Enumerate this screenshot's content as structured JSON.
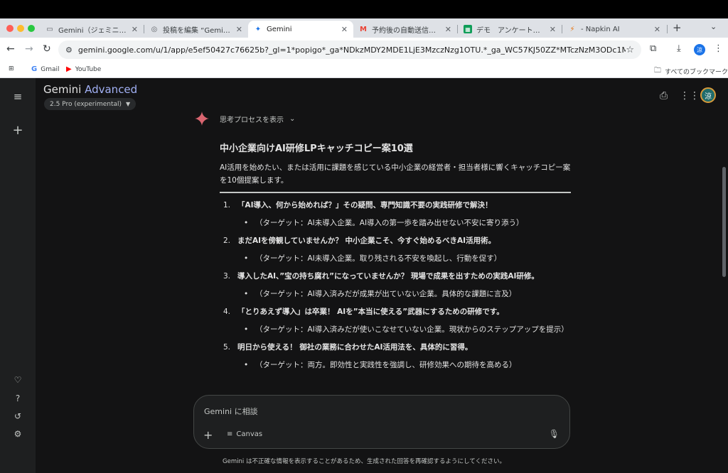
{
  "browser": {
    "tabs": [
      {
        "title": "Gemini（ジェミニ）とは？",
        "icon": "document-icon",
        "active": false
      },
      {
        "title": "投稿を編集 “Gemini（ジェミ",
        "icon": "wordpress-icon",
        "active": false
      },
      {
        "title": "Gemini",
        "icon": "gemini-icon",
        "active": true
      },
      {
        "title": "予約後の自動送信メールの",
        "icon": "gmail-icon",
        "active": false
      },
      {
        "title": "デモ　アンケート結果 - Go",
        "icon": "sheets-icon",
        "active": false
      },
      {
        "title": "- Napkin AI",
        "icon": "napkin-icon",
        "active": false
      }
    ],
    "url": "gemini.google.com/u/1/app/e5ef50427c76625b?_gl=1*popigo*_ga*NDkzMDY2MDE1LjE3MzczNzg1OTU.*_ga_WC57KJ50ZZ*MTczNzM3ODc1MS4xLjAuMTczNzM3...",
    "profile_initial": "涼",
    "bookmarks": [
      {
        "label": "Gmail",
        "icon": "google-icon"
      },
      {
        "label": "YouTube",
        "icon": "youtube-icon"
      }
    ],
    "all_bookmarks_label": "すべてのブックマーク"
  },
  "app": {
    "brand": "Gemini",
    "brand_suffix": "Advanced",
    "model": "2.5 Pro (experimental)",
    "user_initial": "涼",
    "thinking_label": "思考プロセスを表示",
    "response": {
      "title": "中小企業向けAI研修LPキャッチコピー案10選",
      "intro": "AI活用を始めたい、または活用に課題を感じている中小企業の経営者・担当者様に響くキャッチコピー案を10個提案します。",
      "items": [
        {
          "num": "1.",
          "title": "「AI導入、何から始めれば？」その疑問、専門知識不要の実践研修で解決！",
          "sub": "（ターゲット：AI未導入企業。AI導入の第一歩を踏み出せない不安に寄り添う）"
        },
        {
          "num": "2.",
          "title": "まだAIを傍観していませんか？ 中小企業こそ、今すぐ始めるべきAI活用術。",
          "sub": "（ターゲット：AI未導入企業。取り残される不安を喚起し、行動を促す）"
        },
        {
          "num": "3.",
          "title": "導入したAI、”宝の持ち腐れ”になっていませんか？ 現場で成果を出すための実践AI研修。",
          "sub": "（ターゲット：AI導入済みだが成果が出ていない企業。具体的な課題に言及）"
        },
        {
          "num": "4.",
          "title": "「とりあえず導入」は卒業！ AIを”本当に使える”武器にするための研修です。",
          "sub": "（ターゲット：AI導入済みだが使いこなせていない企業。現状からのステップアップを提示）"
        },
        {
          "num": "5.",
          "title": "明日から使える！ 御社の業務に合わせたAI活用法を、具体的に習得。",
          "sub": "（ターゲット：両方。即効性と実践性を強調し、研修効果への期待を高める）"
        }
      ]
    },
    "input_placeholder": "Gemini に相談",
    "canvas_label": "Canvas",
    "disclaimer": "Gemini は不正確な情報を表示することがあるため、生成された回答を再確認するようにしてください。"
  }
}
